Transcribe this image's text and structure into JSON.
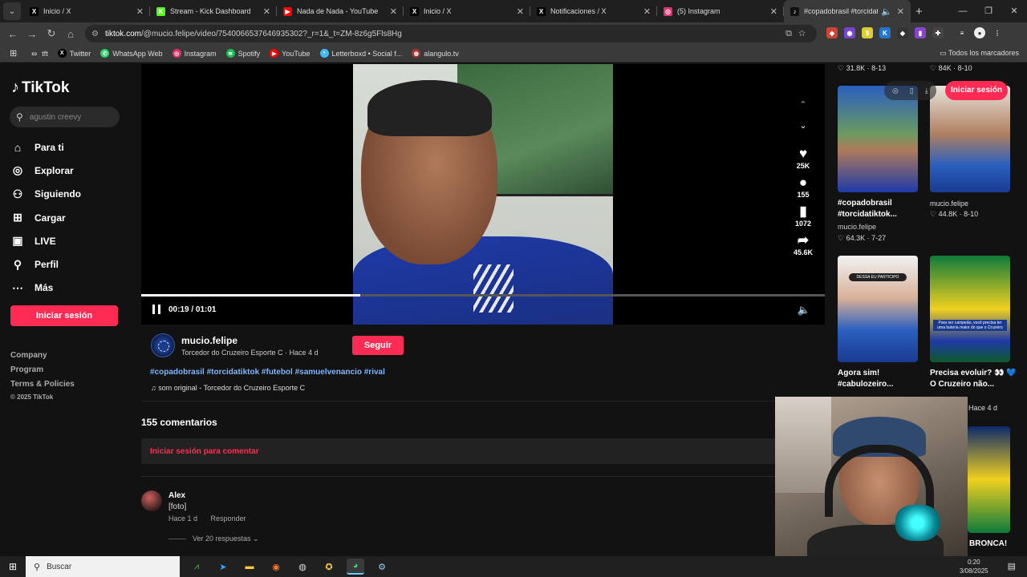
{
  "tabs": [
    {
      "title": "Inicio / X",
      "icon": "x-logo-icon",
      "fav": "X",
      "color": "#000000",
      "active": false
    },
    {
      "title": "Stream - Kick Dashboard",
      "icon": "kick-logo-icon",
      "fav": "K",
      "color": "#53fc18",
      "active": false
    },
    {
      "title": "Nada de Nada - YouTube",
      "icon": "youtube-logo-icon",
      "fav": "▶",
      "color": "#ff0000",
      "active": false
    },
    {
      "title": "Inicio / X",
      "icon": "x-logo-icon",
      "fav": "X",
      "color": "#000000",
      "active": false
    },
    {
      "title": "Notificaciones / X",
      "icon": "x-logo-icon",
      "fav": "X",
      "color": "#000000",
      "active": false
    },
    {
      "title": "(5) Instagram",
      "icon": "instagram-logo-icon",
      "fav": "◎",
      "color": "#e1306c",
      "active": false
    },
    {
      "title": "#copadobrasil #torcidatik",
      "icon": "tiktok-logo-icon",
      "fav": "♪",
      "color": "#111111",
      "active": true
    }
  ],
  "browser": {
    "new_tab": "+",
    "url_host": "tiktok.com",
    "url_path": "/@mucio.felipe/video/7540066537646935302?_r=1&_t=ZM-8z6g5Fls8Hg"
  },
  "bookmarks": [
    {
      "label": "tft",
      "icon": "folder-icon",
      "glyph": "▭",
      "color": "#3a3a3a"
    },
    {
      "label": "Twitter",
      "icon": "x-logo-icon",
      "glyph": "X",
      "color": "#000000"
    },
    {
      "label": "WhatsApp Web",
      "icon": "whatsapp-logo-icon",
      "glyph": "✆",
      "color": "#25d366"
    },
    {
      "label": "Instagram",
      "icon": "instagram-logo-icon",
      "glyph": "◎",
      "color": "#e1306c"
    },
    {
      "label": "Spotify",
      "icon": "spotify-logo-icon",
      "glyph": "≋",
      "color": "#1db954"
    },
    {
      "label": "YouTube",
      "icon": "youtube-logo-icon",
      "glyph": "▶",
      "color": "#ff0000"
    },
    {
      "label": "Letterboxd • Social f...",
      "icon": "letterboxd-logo-icon",
      "glyph": "•",
      "color": "#40bcf4"
    },
    {
      "label": "alangulo.tv",
      "icon": "globe-icon",
      "glyph": "◍",
      "color": "#aa3333"
    }
  ],
  "bookmarks_all": "Todos los marcadores",
  "sidebar": {
    "logo": "TikTok",
    "search_placeholder": "agustin creevy",
    "items": [
      {
        "label": "Para ti",
        "icon": "home-icon",
        "glyph": "⌂"
      },
      {
        "label": "Explorar",
        "icon": "compass-icon",
        "glyph": "◎"
      },
      {
        "label": "Siguiendo",
        "icon": "following-icon",
        "glyph": "⚇"
      },
      {
        "label": "Cargar",
        "icon": "upload-icon",
        "glyph": "⊞"
      },
      {
        "label": "LIVE",
        "icon": "live-icon",
        "glyph": "▣"
      },
      {
        "label": "Perfil",
        "icon": "profile-icon",
        "glyph": "⚲"
      },
      {
        "label": "Más",
        "icon": "more-icon",
        "glyph": "⋯"
      }
    ],
    "login": "Iniciar sesión",
    "footer": [
      "Company",
      "Program",
      "Terms & Policies"
    ],
    "copyright": "© 2025 TikTok"
  },
  "video": {
    "time": "00:19 / 01:01",
    "progress": 0.32,
    "likes": "25K",
    "comments": "155",
    "saves": "1072",
    "shares": "45.6K"
  },
  "author": {
    "name": "mucio.felipe",
    "desc": "Torcedor do Cruzeiro Esporte C · Hace 4 d",
    "follow": "Seguir",
    "tags": "#copadobrasil #torcidatiktok #futebol #samuelvenancio #rival",
    "music": "♫ som original - Torcedor do Cruzeiro Esporte C"
  },
  "comments": {
    "count": "155 comentarios",
    "login_prompt": "Iniciar sesión para comentar",
    "items": [
      {
        "author": "Alex",
        "text": "[foto]",
        "time": "Hace 1 d",
        "reply": "Responder",
        "replies": "Ver 20 respuestas ⌄"
      }
    ]
  },
  "related": {
    "top_stats": [
      "♡ 31.8K · 8-13",
      "♡ 84K · 8-10"
    ],
    "login": "Iniciar sesión",
    "items": [
      {
        "caption": "#copadobrasil #torcidatiktok...",
        "user": "mucio.felipe",
        "stats": "♡ 64.3K · 7-27"
      },
      {
        "caption": "mucio.felipe",
        "user": "",
        "stats": "♡ 44.8K · 8-10"
      },
      {
        "caption": "Agora sim! #cabulozeiro...",
        "user": "",
        "stats": "",
        "overlay": "DESSA EU PARTICIPO"
      },
      {
        "caption": "Precisa evoluir? 👀 💙 O Cruzeiro não...",
        "user": "",
        "stats": "Hace 4 d",
        "overlay": "Para ser campeão, você precisa ter uma bateria maior do que o Cruzeiro"
      },
      {
        "caption": "BRONCA!",
        "user": ""
      }
    ]
  },
  "taskbar": {
    "search": "Buscar",
    "time": "0:20",
    "date": "3/08/2025"
  }
}
